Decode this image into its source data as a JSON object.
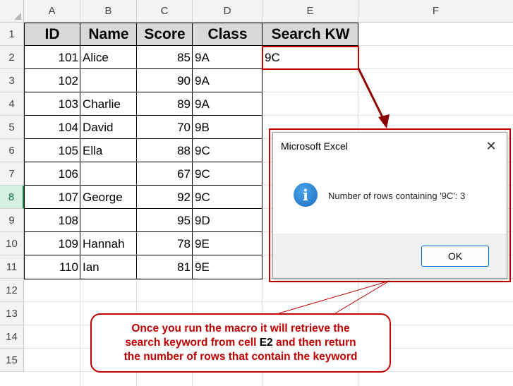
{
  "columns": [
    "A",
    "B",
    "C",
    "D",
    "E",
    "F"
  ],
  "rows": [
    "1",
    "2",
    "3",
    "4",
    "5",
    "6",
    "7",
    "8",
    "9",
    "10",
    "11",
    "12",
    "13",
    "14",
    "15"
  ],
  "selected_row": "8",
  "table": {
    "headers": [
      "ID",
      "Name",
      "Score",
      "Class"
    ],
    "data": [
      {
        "id": "101",
        "name": "Alice",
        "score": "85",
        "class": "9A"
      },
      {
        "id": "102",
        "name": "",
        "score": "90",
        "class": "9A"
      },
      {
        "id": "103",
        "name": "Charlie",
        "score": "89",
        "class": "9A"
      },
      {
        "id": "104",
        "name": "David",
        "score": "70",
        "class": "9B"
      },
      {
        "id": "105",
        "name": "Ella",
        "score": "88",
        "class": "9C"
      },
      {
        "id": "106",
        "name": "",
        "score": "67",
        "class": "9C"
      },
      {
        "id": "107",
        "name": "George",
        "score": "92",
        "class": "9C"
      },
      {
        "id": "108",
        "name": "",
        "score": "95",
        "class": "9D"
      },
      {
        "id": "109",
        "name": "Hannah",
        "score": "78",
        "class": "9E"
      },
      {
        "id": "110",
        "name": "Ian",
        "score": "81",
        "class": "9E"
      }
    ]
  },
  "search": {
    "header": "Search KW",
    "value": "9C"
  },
  "dialog": {
    "title": "Microsoft Excel",
    "close_glyph": "✕",
    "icon_glyph": "i",
    "message": "Number of rows containing '9C': 3",
    "ok_label": "OK"
  },
  "callout": {
    "line1": "Once you run the macro it will retrieve the",
    "line2_prefix": "search keyword from cell ",
    "line2_bold": "E2",
    "line2_suffix": " and then return",
    "line3": "the number of rows that contain the keyword"
  },
  "colors": {
    "accent_red": "#c00000",
    "header_fill": "#d9d9d9",
    "selection_green": "#107c41"
  }
}
